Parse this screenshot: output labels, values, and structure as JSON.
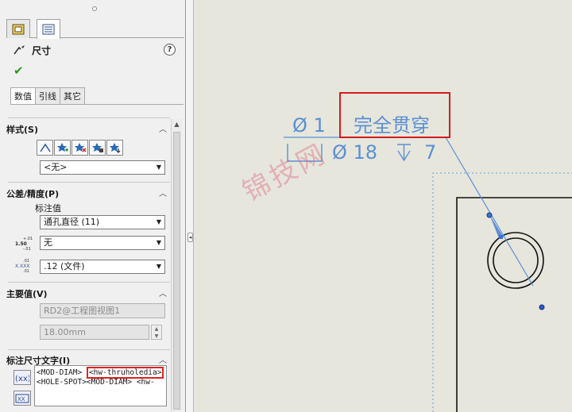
{
  "panel_tabs": [
    "dimxpert-tab",
    "property-tab"
  ],
  "title": "尺寸",
  "help_label": "?",
  "ok_label": "✔",
  "subtabs": [
    "数值",
    "引线",
    "其它"
  ],
  "sections": {
    "style": {
      "title": "样式(S)",
      "select": "<无>"
    },
    "tolerance": {
      "title": "公差/精度(P)",
      "label": "标注值",
      "select1": "通孔直径 (11)",
      "select2": "无",
      "select3": ".12 (文件)"
    },
    "primary": {
      "title": "主要值(V)",
      "ref": "RD2@工程图视图1",
      "value": "18.00mm"
    },
    "dimtext": {
      "title": "标注尺寸文字(I)",
      "line1_a": "<MOD-DIAM>",
      "line1_b": "<hw-thruholedia>",
      "line2": "<HOLE-SPOT><MOD-DIAM> <hw-"
    }
  },
  "drawing": {
    "callout_line1_sym": "Ø 1",
    "callout_line1_text": "完全贯穿",
    "callout_line2_sym": "Ø 18",
    "callout_line2_depth": "7"
  },
  "watermark": "锦技网",
  "colors": {
    "annotation": "#5b8fd6",
    "highlight": "#d21c1c",
    "canvas": "#e6e6dc"
  }
}
